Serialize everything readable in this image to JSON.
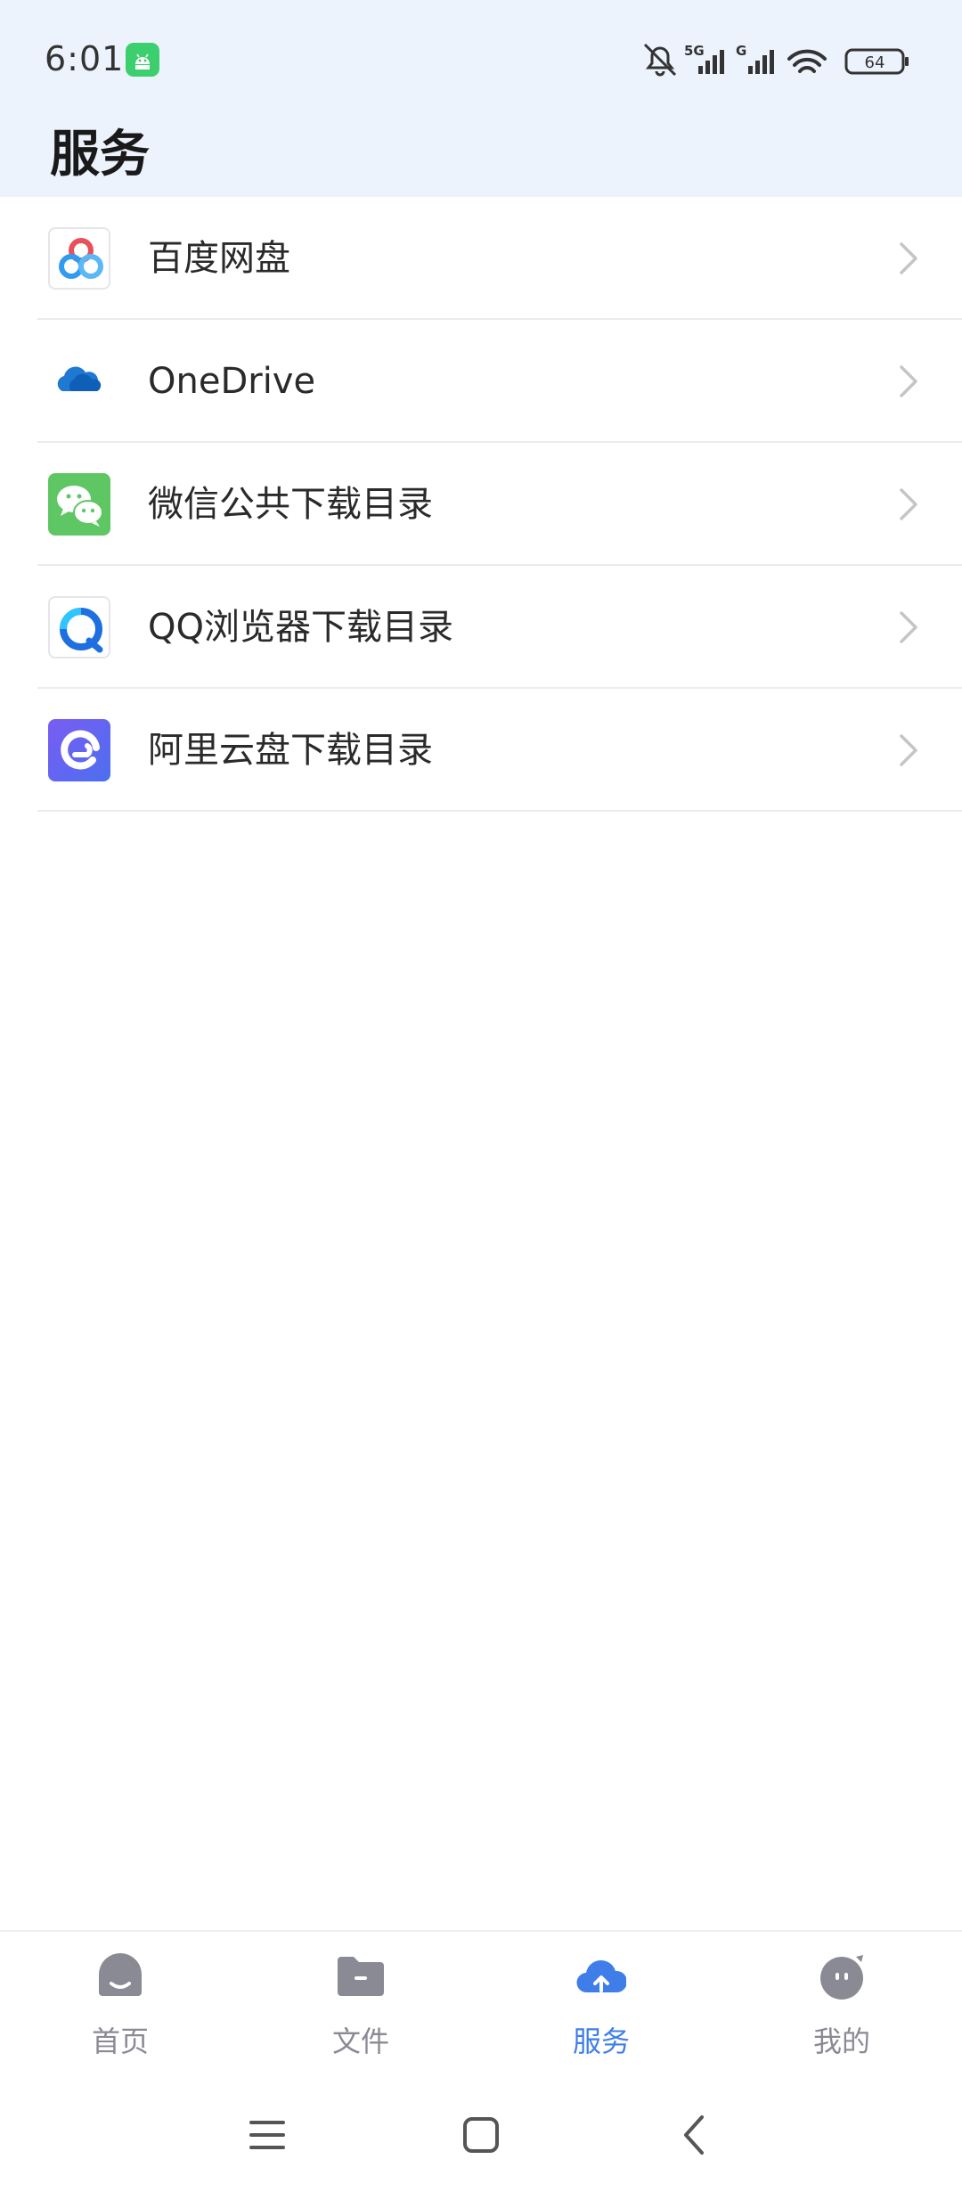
{
  "status_bar": {
    "time": "6:01",
    "network_1": "5G",
    "network_2": "G",
    "battery": "64"
  },
  "header": {
    "title": "服务"
  },
  "services": [
    {
      "label": "百度网盘",
      "icon": "baidu-netdisk-icon"
    },
    {
      "label": "OneDrive",
      "icon": "onedrive-icon"
    },
    {
      "label": "微信公共下载目录",
      "icon": "wechat-icon"
    },
    {
      "label": "QQ浏览器下载目录",
      "icon": "qq-browser-icon"
    },
    {
      "label": "阿里云盘下载目录",
      "icon": "aliyun-drive-icon"
    }
  ],
  "bottom_nav": {
    "tabs": [
      {
        "label": "首页",
        "icon": "home-icon"
      },
      {
        "label": "文件",
        "icon": "folder-icon"
      },
      {
        "label": "服务",
        "icon": "cloud-upload-icon",
        "active": true
      },
      {
        "label": "我的",
        "icon": "profile-face-icon"
      }
    ]
  },
  "colors": {
    "header_bg": "#edf3fd",
    "accent": "#3f7ee8",
    "inactive": "#8a8a94"
  }
}
